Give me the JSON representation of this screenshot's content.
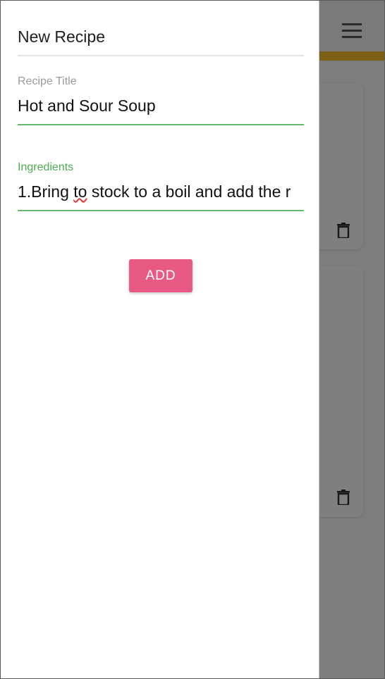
{
  "drawer": {
    "title": "New Recipe",
    "recipe_title_field": {
      "label": "Recipe Title",
      "value": "Hot and Sour Soup"
    },
    "ingredients_field": {
      "label": "Ingredients",
      "value_before": "1.Bring ",
      "value_misspelled": "to",
      "value_after": " stock to a boil and add the r"
    },
    "add_label": "ADD"
  },
  "background": {
    "menu_icon": "hamburger-menu-icon",
    "card_icon": "trash-icon"
  },
  "colors": {
    "accent_bar": "#fbc02d",
    "focus_green": "#66bb6a",
    "label_green": "#4caf50",
    "add_button": "#e85a84",
    "scrim": "rgba(0,0,0,0.5)"
  }
}
